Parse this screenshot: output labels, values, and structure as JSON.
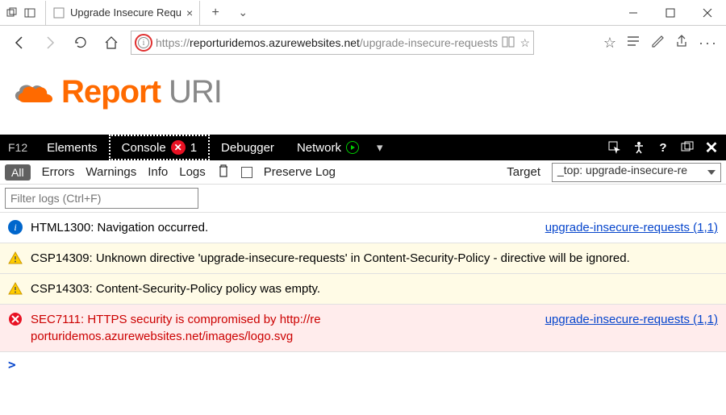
{
  "window": {
    "tab_title": "Upgrade Insecure Requ",
    "url_host": "reporturidemos.azurewebsites.net",
    "url_proto": "https://",
    "url_path": "/upgrade-insecure-requests"
  },
  "page": {
    "logo_part1": "Report",
    "logo_part2": " URI"
  },
  "devtools": {
    "f12": "F12",
    "tabs": {
      "elements": "Elements",
      "console": "Console",
      "debugger": "Debugger",
      "network": "Network"
    },
    "console_error_count": "1",
    "toolbar": {
      "all": "All",
      "errors": "Errors",
      "warnings": "Warnings",
      "info": "Info",
      "logs": "Logs",
      "preserve": "Preserve Log",
      "target_label": "Target",
      "target_value": "_top: upgrade-insecure-re",
      "filter_placeholder": "Filter logs (Ctrl+F)"
    },
    "messages": [
      {
        "type": "info",
        "text": "HTML1300: Navigation occurred.",
        "link": "upgrade-insecure-requests (1,1)"
      },
      {
        "type": "warn",
        "text": "CSP14309: Unknown directive 'upgrade-insecure-requests' in Content-Security-Policy - directive will be ignored."
      },
      {
        "type": "warn",
        "text": "CSP14303: Content-Security-Policy policy was empty."
      },
      {
        "type": "err",
        "text_pre": "SEC7111: HTTPS security is compromised by http://re",
        "text_post": "porturidemos.azurewebsites.net/images/logo.svg",
        "link": "upgrade-insecure-requests (1,1)"
      }
    ],
    "prompt": ">"
  }
}
